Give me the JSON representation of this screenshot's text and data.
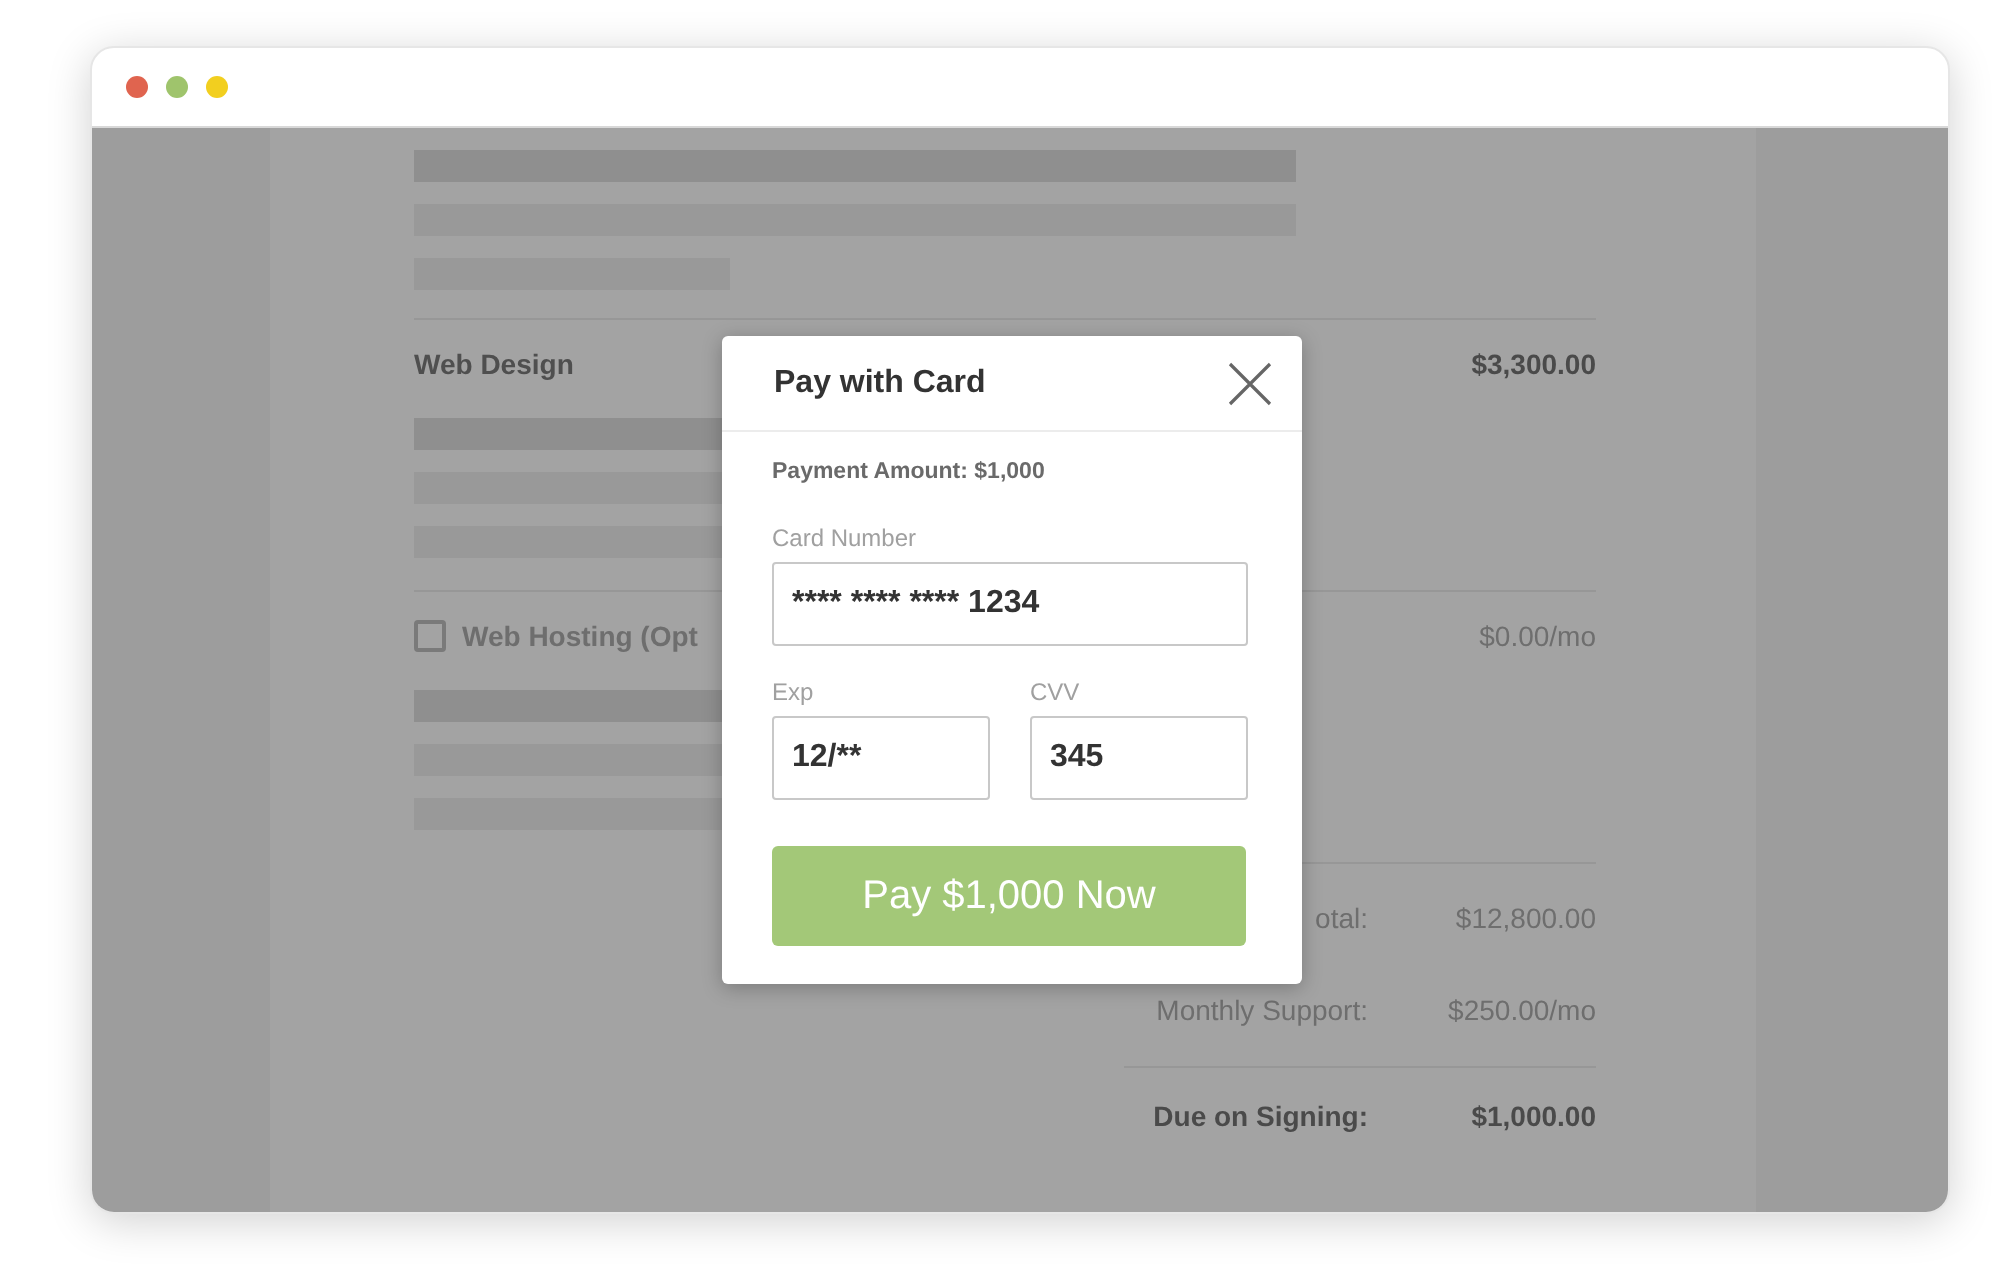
{
  "browser": {
    "controls": [
      {
        "color": "#e0644f"
      },
      {
        "color": "#9fc46c"
      },
      {
        "color": "#f2cf1f"
      }
    ]
  },
  "invoice": {
    "sections": [
      {
        "kind": "item",
        "title": "Web Design",
        "price": "$3,300.00"
      },
      {
        "kind": "option",
        "title": "Web Hosting (Opt",
        "price": "$0.00/mo",
        "checked": false
      }
    ],
    "totals": [
      {
        "label": "otal:",
        "value": "$12,800.00"
      },
      {
        "label": "Monthly Support:",
        "value": "$250.00/mo"
      }
    ],
    "due": {
      "label": "Due on Signing:",
      "value": "$1,000.00"
    }
  },
  "dialog": {
    "title": "Pay with Card",
    "amount": "Payment Amount: $1,000",
    "fields": [
      {
        "label": "Card Number",
        "value": "**** **** **** 1234"
      },
      {
        "label": "Exp",
        "value": "12/**"
      },
      {
        "label": "CVV",
        "value": "345"
      }
    ],
    "button": "Pay $1,000 Now"
  }
}
